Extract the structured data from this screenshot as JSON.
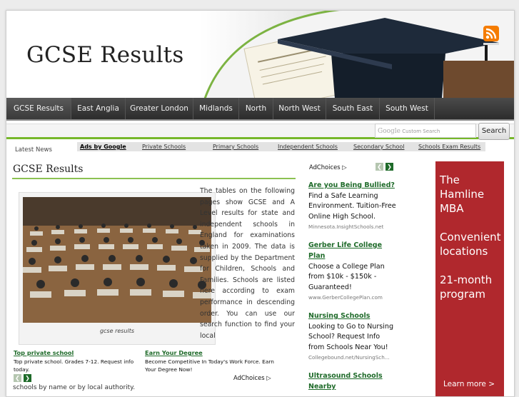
{
  "site": {
    "title": "GCSE Results"
  },
  "nav": {
    "items": [
      "GCSE Results",
      "East Anglia",
      "Greater London",
      "Midlands",
      "North",
      "North West",
      "South East",
      "South West"
    ]
  },
  "search": {
    "brand": "Google",
    "placeholder": "Custom Search",
    "button": "Search"
  },
  "latest_news": "Latest News",
  "linkbar": {
    "ads_label": "Ads by Google",
    "links": [
      "Private Schools",
      "Primary Schools",
      "Independent Schools",
      "Secondary School",
      "Schools Exam Results"
    ]
  },
  "main": {
    "title": "GCSE Results",
    "photo_caption": "gcse results",
    "body": "The tables on the following pages show GCSE and A Level results for state and independent schools in England for examinations taken in 2009. The data is supplied by the Department for Children, Schools and Families. Schools are listed here according to exam performance in descending order. You can use our search function to find your local",
    "continued": "schools by name or by local authority."
  },
  "bottom_ads": {
    "items": [
      {
        "title": "Top private school",
        "desc": "Top private school. Grades 7-12. Request info today."
      },
      {
        "title": "Earn Your Degree",
        "desc": "Become Competitive In Today's Work Force. Earn Your Degree Now!"
      }
    ],
    "adchoices": "AdChoices"
  },
  "right_ads": {
    "adchoices": "AdChoices",
    "items": [
      {
        "title": "Are you Being Bullied?",
        "desc": "Find a Safe Learning Environment. Tuition-Free Online High School.",
        "url": "Minnesota.InsightSchools.net"
      },
      {
        "title": "Gerber Life College Plan",
        "desc": "Choose a College Plan from $10k - $150k - Guaranteed!",
        "url": "www.GerberCollegePlan.com"
      },
      {
        "title": "Nursing Schools",
        "desc": "Looking to Go to Nursing School? Request Info from Schools Near You!",
        "url": "Collegebound.net/NursingSch..."
      },
      {
        "title": "Ultrasound Schools Nearby",
        "desc": "",
        "url": ""
      }
    ]
  },
  "banner_ad": {
    "lines": [
      "The",
      "Hamline",
      "MBA",
      "",
      "Convenient",
      "locations",
      "",
      "21-month",
      "program"
    ],
    "more": "Learn more >"
  },
  "icons": {
    "rss": "rss-icon",
    "prev": "chevron-left-icon",
    "next": "chevron-right-icon",
    "adchoices": "adchoices-icon"
  },
  "colors": {
    "accent_green": "#76b82a",
    "nav_bg": "#2c2c2c",
    "ad_green": "#1f6b2a",
    "banner_red": "#b0282d",
    "rss_orange": "#f57c00"
  }
}
